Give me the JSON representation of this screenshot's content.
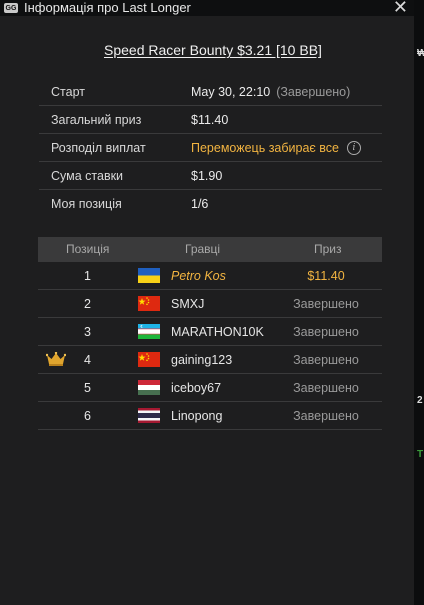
{
  "window": {
    "title": "Інформація про Last Longer",
    "app_icon_text": "GG"
  },
  "heading": "Speed Racer Bounty $3.21 [10 BB]",
  "info": [
    {
      "label": "Старт",
      "value": "May 30, 22:10",
      "note": "(Завершено)"
    },
    {
      "label": "Загальний приз",
      "value": "$11.40"
    },
    {
      "label": "Розподіл виплат",
      "value": "Переможець забирає все",
      "icon": "info-icon"
    },
    {
      "label": "Сума ставки",
      "value": "$1.90"
    },
    {
      "label": "Моя позиція",
      "value": "1/6"
    }
  ],
  "table": {
    "headers": {
      "position": "Позиція",
      "players": "Гравці",
      "prize": "Приз"
    },
    "rows": [
      {
        "pos": "1",
        "flag": "ukraine",
        "name": "Petro Kos",
        "prize": "$11.40",
        "me": true
      },
      {
        "pos": "2",
        "flag": "china",
        "name": "SMXJ",
        "prize": "Завершено"
      },
      {
        "pos": "3",
        "flag": "uzbekistan",
        "name": "MARATHON10K",
        "prize": "Завершено"
      },
      {
        "pos": "4",
        "flag": "china",
        "name": "gaining123",
        "prize": "Завершено",
        "crown": true
      },
      {
        "pos": "5",
        "flag": "hungary",
        "name": "iceboy67",
        "prize": "Завершено"
      },
      {
        "pos": "6",
        "flag": "thailand",
        "name": "Linopong",
        "prize": "Завершено"
      }
    ]
  },
  "colors": {
    "accent": "#f2b441",
    "panel": "#1e1e1f",
    "header_bg": "#3a3a3b"
  }
}
